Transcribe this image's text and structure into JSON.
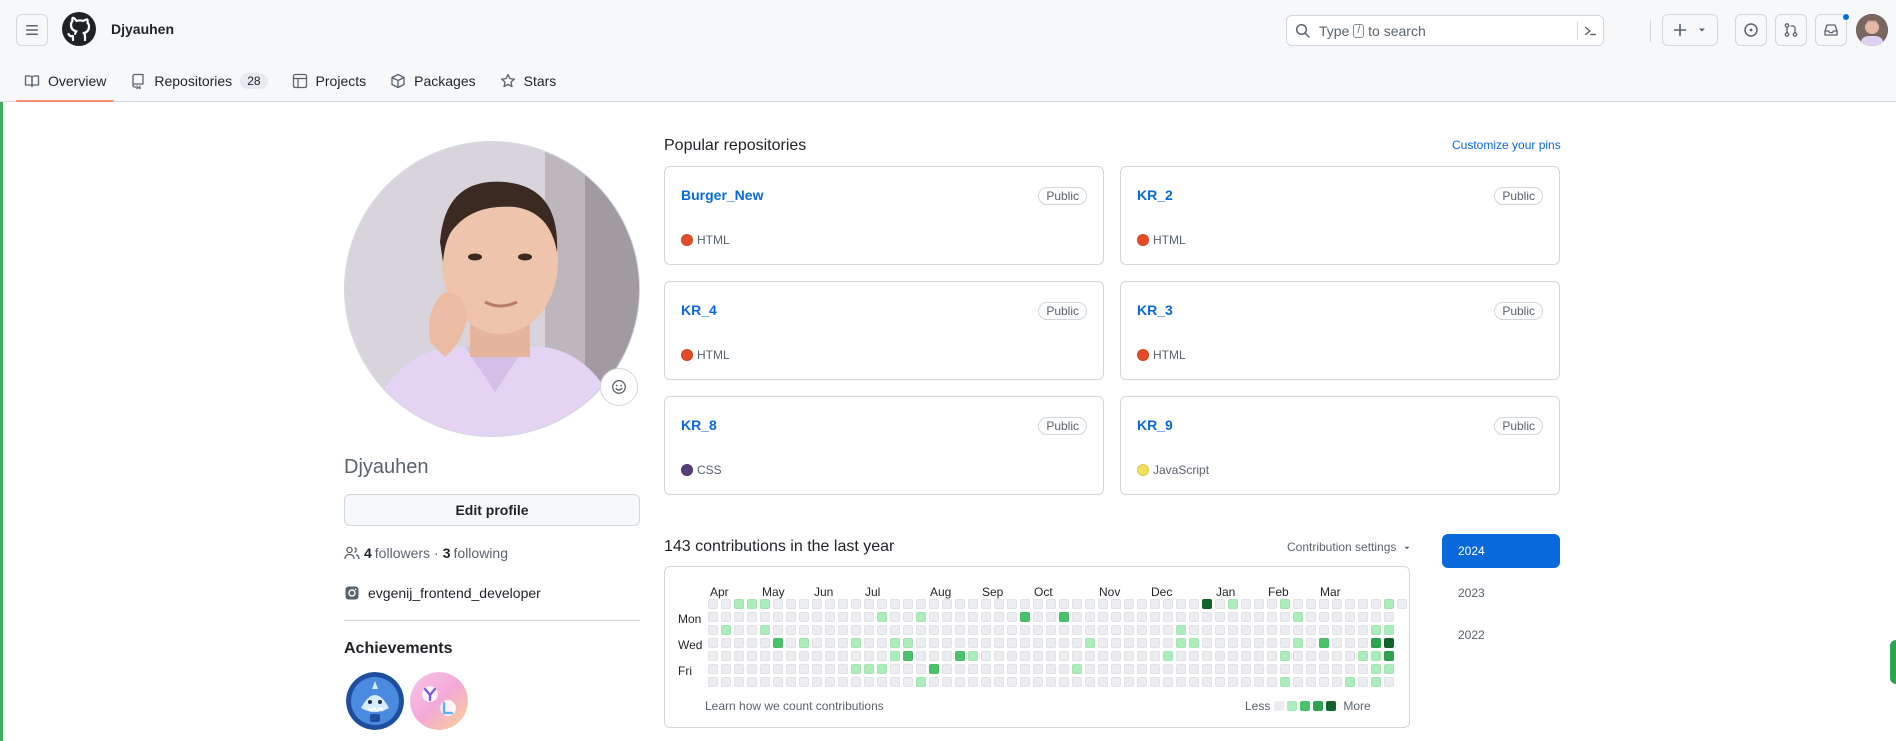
{
  "header": {
    "username": "Djyauhen",
    "search": {
      "before": "Type",
      "key": "/",
      "after": "to search"
    }
  },
  "tabs": [
    {
      "label": "Overview",
      "count": null
    },
    {
      "label": "Repositories",
      "count": "28"
    },
    {
      "label": "Projects",
      "count": null
    },
    {
      "label": "Packages",
      "count": null
    },
    {
      "label": "Stars",
      "count": null
    }
  ],
  "profile": {
    "name": "Djyauhen",
    "edit_label": "Edit profile",
    "followers_count": "4",
    "followers_label": "followers",
    "dot": "·",
    "following_count": "3",
    "following_label": "following",
    "social": "evgenij_frontend_developer",
    "achievements_title": "Achievements"
  },
  "popular": {
    "title": "Popular repositories",
    "customize": "Customize your pins",
    "repos": [
      {
        "name": "Burger_New",
        "visibility": "Public",
        "language": "HTML",
        "color": "#e34c26"
      },
      {
        "name": "KR_2",
        "visibility": "Public",
        "language": "HTML",
        "color": "#e34c26"
      },
      {
        "name": "KR_4",
        "visibility": "Public",
        "language": "HTML",
        "color": "#e34c26"
      },
      {
        "name": "KR_3",
        "visibility": "Public",
        "language": "HTML",
        "color": "#e34c26"
      },
      {
        "name": "KR_8",
        "visibility": "Public",
        "language": "CSS",
        "color": "#563d7c"
      },
      {
        "name": "KR_9",
        "visibility": "Public",
        "language": "JavaScript",
        "color": "#f1e05a"
      }
    ]
  },
  "contributions": {
    "title": "143 contributions in the last year",
    "settings": "Contribution settings",
    "months": [
      "Apr",
      "May",
      "Jun",
      "Jul",
      "Aug",
      "Sep",
      "Oct",
      "Nov",
      "Dec",
      "Jan",
      "Feb",
      "Mar"
    ],
    "days": [
      "Mon",
      "Wed",
      "Fri"
    ],
    "learn": "Learn how we count contributions",
    "less": "Less",
    "more": "More",
    "levels": [
      "#ebedf0",
      "#aceebb",
      "#4ac26b",
      "#2da44e",
      "#116329"
    ]
  },
  "years": [
    "2024",
    "2023",
    "2022"
  ]
}
